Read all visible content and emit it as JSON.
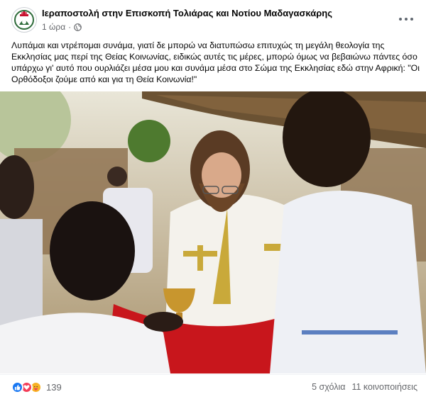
{
  "post": {
    "page_name": "Ιεραποστολή στην Επισκοπή Τολιάρας και Νοτίου Μαδαγασκάρης",
    "time": "1 ώρα",
    "separator": "·",
    "text": "Λυπάμαι και ντρέπομαι συνάμα, γιατί δε μπορώ να διατυπώσω επιτυχώς τη μεγάλη θεολογία της Εκκλησίας μας περί της Θείας Κοινωνίας, ειδικώς αυτές τις μέρες, μπορώ όμως να βεβαιώνω πάντες όσο υπάρχω γι' αυτό που ουρλιάζει μέσα μου και συνάμα μέσα στο Σώμα της Εκκλησίας εδώ στην Αφρική: \"Οι Ορθόδοξοι ζούμε από και για τη Θεία Κοινωνία!\""
  },
  "icons": {
    "avatar": "church-emblem-icon",
    "privacy": "globe-icon",
    "more": "more-options-icon",
    "reactions": [
      "like-icon",
      "love-icon",
      "care-icon"
    ]
  },
  "reactions": {
    "count": "139"
  },
  "stats": {
    "comments": "5 σχόλια",
    "shares": "11 κοινοποιήσεις"
  },
  "colors": {
    "like": "#1877f2",
    "love": "#f33e58",
    "care": "#f7b125",
    "secondary_text": "#65676b"
  }
}
